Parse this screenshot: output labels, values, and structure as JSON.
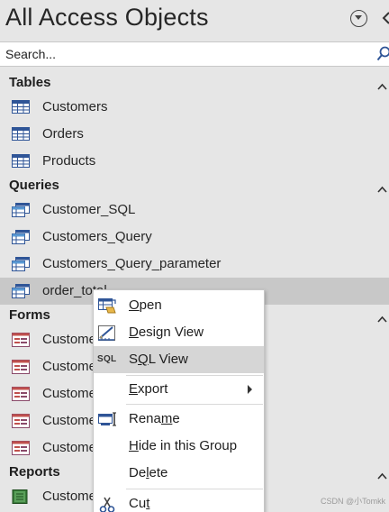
{
  "header": {
    "title": "All Access Objects",
    "menu_icon": "dropdown-circle-icon",
    "collapse_icon": "chevron-left-icon"
  },
  "search": {
    "placeholder": "Search...",
    "icon": "magnifier-icon"
  },
  "groups": {
    "tables": {
      "label": "Tables",
      "items": [
        "Customers",
        "Orders",
        "Products"
      ]
    },
    "queries": {
      "label": "Queries",
      "items": [
        "Customer_SQL",
        "Customers_Query",
        "Customers_Query_parameter",
        "order_total"
      ]
    },
    "forms": {
      "label": "Forms",
      "items": [
        "Customers",
        "Customers",
        "Customers",
        "Customers",
        "Customers"
      ]
    },
    "reports": {
      "label": "Reports",
      "items": [
        "Customers"
      ]
    }
  },
  "selected_item": "order_total",
  "context_menu": {
    "items": [
      {
        "label": "Open",
        "mnemonic": "O",
        "icon": "open-form-icon"
      },
      {
        "label": "Design View",
        "mnemonic": "D",
        "icon": "design-view-icon"
      },
      {
        "label": "SQL View",
        "mnemonic": "Q",
        "icon": "sql-icon",
        "icon_text": "SQL",
        "highlighted": true
      },
      {
        "label": "Export",
        "mnemonic": "E",
        "submenu": true
      },
      {
        "label": "Rename",
        "mnemonic": "m",
        "icon": "rename-icon"
      },
      {
        "label": "Hide in this Group",
        "mnemonic": "H"
      },
      {
        "label": "Delete",
        "mnemonic": "l"
      },
      {
        "label": "Cut",
        "mnemonic": "t",
        "icon": "scissors-icon"
      }
    ]
  },
  "watermark": "CSDN @小Tomkk",
  "colors": {
    "pane_bg": "#e6e6e6",
    "selected_bg": "#c8c8c8",
    "menu_hover": "#d6d6d6",
    "table_icon": "#2f5597",
    "form_icon": "#c0504d",
    "report_icon": "#3a7a3a"
  }
}
